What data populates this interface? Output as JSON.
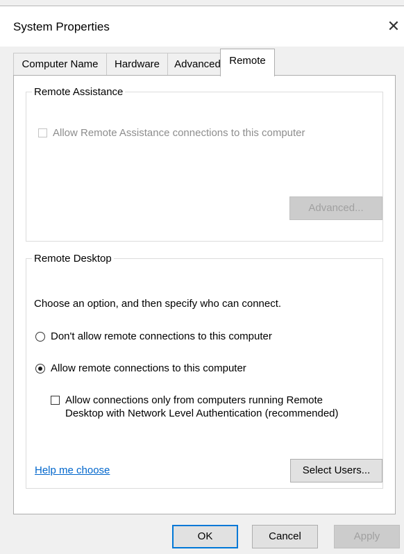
{
  "window": {
    "title": "System Properties",
    "close_glyph": "✕"
  },
  "tabs": [
    {
      "label": "Computer Name",
      "active": false
    },
    {
      "label": "Hardware",
      "active": false
    },
    {
      "label": "Advanced",
      "active": false
    },
    {
      "label": "Remote",
      "active": true
    }
  ],
  "remote_assistance": {
    "legend": "Remote Assistance",
    "allow_checkbox": {
      "label": "Allow Remote Assistance connections to this computer",
      "checked": false,
      "enabled": false
    },
    "advanced_button": {
      "label": "Advanced...",
      "enabled": false
    }
  },
  "remote_desktop": {
    "legend": "Remote Desktop",
    "instruction": "Choose an option, and then specify who can connect.",
    "options": [
      {
        "label": "Don't allow remote connections to this computer",
        "selected": false
      },
      {
        "label": "Allow remote connections to this computer",
        "selected": true
      }
    ],
    "nla_checkbox": {
      "label_line1": "Allow connections only from computers running Remote",
      "label_line2": "Desktop with Network Level Authentication (recommended)",
      "checked": false
    },
    "help_link": "Help me choose",
    "select_users_button": "Select Users..."
  },
  "footer": {
    "ok": "OK",
    "cancel": "Cancel",
    "apply": "Apply"
  }
}
